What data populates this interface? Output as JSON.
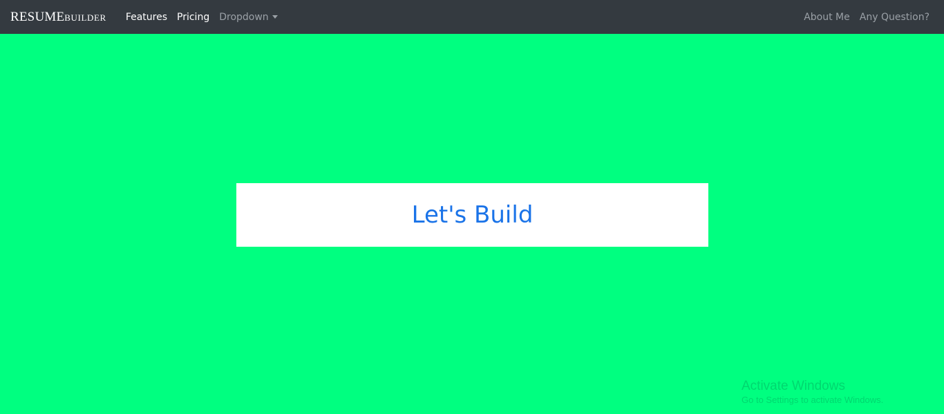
{
  "navbar": {
    "brand_main": "RESUME",
    "brand_small": "builder",
    "left_links": [
      {
        "label": "Features"
      },
      {
        "label": "Pricing"
      },
      {
        "label": "Dropdown"
      }
    ],
    "right_links": [
      {
        "label": "About Me"
      },
      {
        "label": "Any Question?"
      }
    ]
  },
  "hero": {
    "title": "Let's Build"
  },
  "watermark": {
    "title": "Activate Windows",
    "subtitle": "Go to Settings to activate Windows."
  },
  "colors": {
    "navbar_bg": "#343a40",
    "page_bg": "#00ff80",
    "hero_text": "#1a73e8"
  }
}
